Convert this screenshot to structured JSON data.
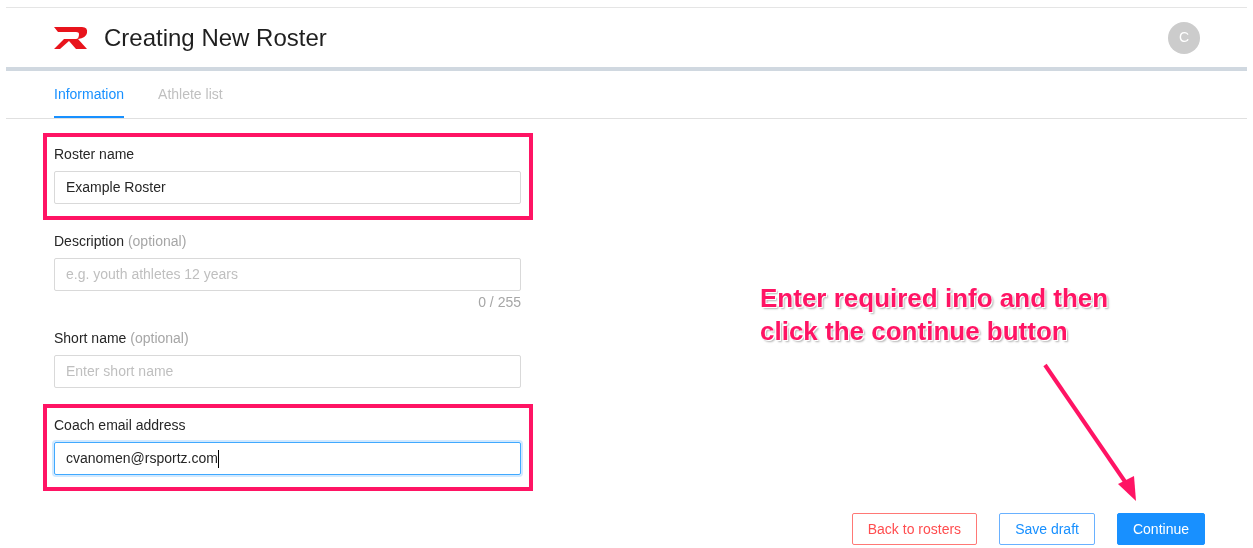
{
  "header": {
    "title": "Creating New Roster",
    "avatar": "C"
  },
  "tabs": [
    {
      "label": "Information",
      "selected": true
    },
    {
      "label": "Athlete list",
      "selected": false
    }
  ],
  "fields": [
    {
      "label": "Roster name",
      "value": "Example Roster",
      "highlighted": true,
      "focused": false
    },
    {
      "label": "Description",
      "hint": "(optional)",
      "placeholder": "e.g. youth athletes 12 years",
      "counter": "0 / 255",
      "highlighted": false,
      "focused": false
    },
    {
      "label": "Short name",
      "hint": "(optional)",
      "placeholder": "Enter short name",
      "highlighted": false,
      "focused": false
    },
    {
      "label": "Coach email address",
      "value": "cvanomen@rsportz.com",
      "highlighted": true,
      "focused": true
    }
  ],
  "annotation": {
    "lines": [
      "Enter required info and then",
      "click the continue button"
    ]
  },
  "buttons": [
    {
      "label": "Back to rosters",
      "kind": "danger"
    },
    {
      "label": "Save draft",
      "kind": "outline"
    },
    {
      "label": "Continue",
      "kind": "primary"
    }
  ]
}
